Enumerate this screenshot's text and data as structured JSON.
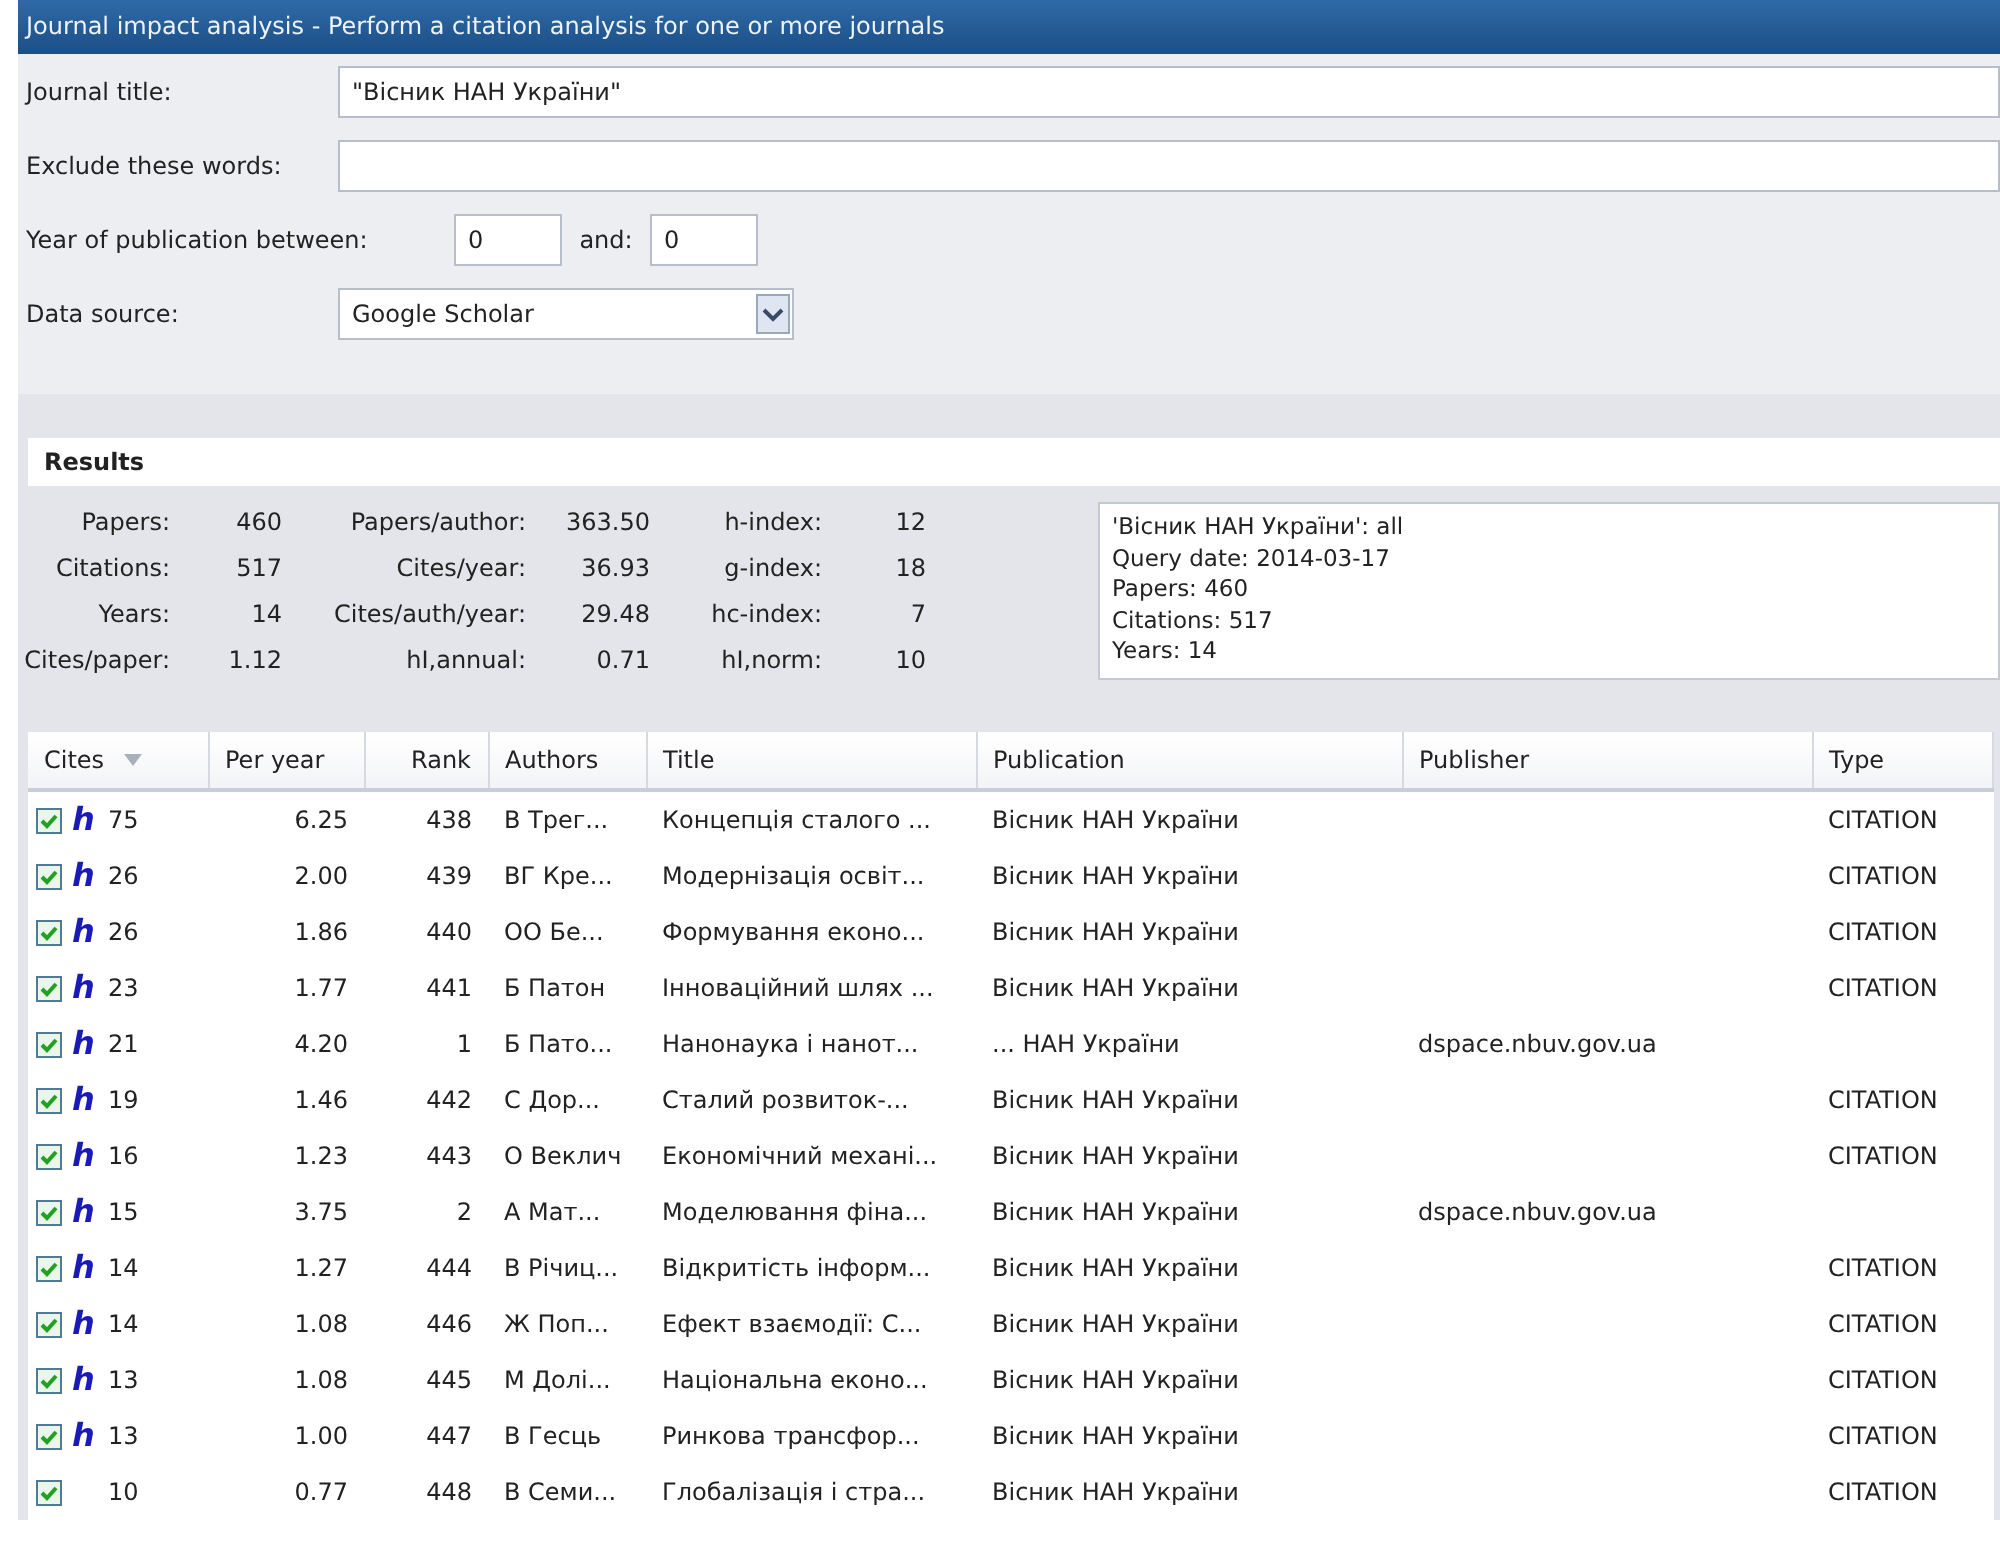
{
  "window": {
    "title": "Journal impact analysis - Perform a citation analysis for one or more journals"
  },
  "form": {
    "journal_title": {
      "label": "Journal title:",
      "value": "\"Вісник НАН України\""
    },
    "exclude": {
      "label": "Exclude these words:"
    },
    "year": {
      "label": "Year of publication between:",
      "from": "0",
      "and_label": "and:",
      "to": "0"
    },
    "data_source": {
      "label": "Data source:",
      "value": "Google Scholar"
    }
  },
  "results": {
    "heading": "Results",
    "stats": [
      [
        {
          "label": "Papers:",
          "value": "460"
        },
        {
          "label": "Papers/author:",
          "value": "363.50"
        },
        {
          "label": "h-index:",
          "value": "12"
        }
      ],
      [
        {
          "label": "Citations:",
          "value": "517"
        },
        {
          "label": "Cites/year:",
          "value": "36.93"
        },
        {
          "label": "g-index:",
          "value": "18"
        }
      ],
      [
        {
          "label": "Years:",
          "value": "14"
        },
        {
          "label": "Cites/auth/year:",
          "value": "29.48"
        },
        {
          "label": "hc-index:",
          "value": "7"
        }
      ],
      [
        {
          "label": "Cites/paper:",
          "value": "1.12"
        },
        {
          "label": "hI,annual:",
          "value": "0.71"
        },
        {
          "label": "hI,norm:",
          "value": "10"
        }
      ]
    ],
    "summary": [
      "'Вісник НАН України': all",
      "Query date: 2014-03-17",
      "Papers: 460",
      "Citations: 517",
      "Years: 14"
    ]
  },
  "table": {
    "columns": [
      {
        "label": "Cites",
        "sorted": true
      },
      {
        "label": "Per year",
        "sorted": false
      },
      {
        "label": "Rank",
        "sorted": false
      },
      {
        "label": "Authors",
        "sorted": false
      },
      {
        "label": "Title",
        "sorted": false
      },
      {
        "label": "Publication",
        "sorted": false
      },
      {
        "label": "Publisher",
        "sorted": false
      },
      {
        "label": "Type",
        "sorted": false
      }
    ],
    "rows": [
      {
        "checked": true,
        "marker": "h",
        "cites": "75",
        "per_year": "6.25",
        "rank": "438",
        "authors": "В Трег...",
        "title": "Концепція сталого ...",
        "publication": "Вісник НАН України",
        "type": "CITATION"
      },
      {
        "checked": true,
        "marker": "h",
        "cites": "26",
        "per_year": "2.00",
        "rank": "439",
        "authors": "ВГ Кре...",
        "title": "Модернізація освіт...",
        "publication": "Вісник НАН України",
        "type": "CITATION"
      },
      {
        "checked": true,
        "marker": "h",
        "cites": "26",
        "per_year": "1.86",
        "rank": "440",
        "authors": "ОО Бе...",
        "title": "Формування еконо...",
        "publication": "Вісник НАН України",
        "type": "CITATION"
      },
      {
        "checked": true,
        "marker": "h",
        "cites": "23",
        "per_year": "1.77",
        "rank": "441",
        "authors": "Б Патон",
        "title": "Інноваційний шлях ...",
        "publication": "Вісник НАН України",
        "type": "CITATION"
      },
      {
        "checked": true,
        "marker": "h",
        "cites": "21",
        "per_year": "4.20",
        "rank": "1",
        "authors": "Б Пато...",
        "title": "Нанонаука і нанот...",
        "publication": "... НАН України",
        "publisher": "dspace.nbuv.gov.ua"
      },
      {
        "checked": true,
        "marker": "h",
        "cites": "19",
        "per_year": "1.46",
        "rank": "442",
        "authors": "С Дор...",
        "title": "Сталий розвиток-...",
        "publication": "Вісник НАН України",
        "type": "CITATION"
      },
      {
        "checked": true,
        "marker": "h",
        "cites": "16",
        "per_year": "1.23",
        "rank": "443",
        "authors": "О Веклич",
        "title": "Економічний механі...",
        "publication": "Вісник НАН України",
        "type": "CITATION"
      },
      {
        "checked": true,
        "marker": "h",
        "cites": "15",
        "per_year": "3.75",
        "rank": "2",
        "authors": "А Мат...",
        "title": "Моделювання фіна...",
        "publication": "Вісник НАН України",
        "publisher": "dspace.nbuv.gov.ua"
      },
      {
        "checked": true,
        "marker": "h",
        "cites": "14",
        "per_year": "1.27",
        "rank": "444",
        "authors": "В Річиц...",
        "title": "Відкритість інформ...",
        "publication": "Вісник НАН України",
        "type": "CITATION"
      },
      {
        "checked": true,
        "marker": "h",
        "cites": "14",
        "per_year": "1.08",
        "rank": "446",
        "authors": "Ж Поп...",
        "title": "Ефект взаємодії: С...",
        "publication": "Вісник НАН України",
        "type": "CITATION"
      },
      {
        "checked": true,
        "marker": "h",
        "cites": "13",
        "per_year": "1.08",
        "rank": "445",
        "authors": "М Долі...",
        "title": "Національна еконо...",
        "publication": "Вісник НАН України",
        "type": "CITATION"
      },
      {
        "checked": true,
        "marker": "h",
        "cites": "13",
        "per_year": "1.00",
        "rank": "447",
        "authors": "В Гесць",
        "title": "Ринкова трансфор...",
        "publication": "Вісник НАН України",
        "type": "CITATION"
      },
      {
        "checked": true,
        "cites": "10",
        "per_year": "0.77",
        "rank": "448",
        "authors": "В Семи...",
        "title": "Глобалізація і стра...",
        "publication": "Вісник НАН України",
        "type": "CITATION"
      }
    ]
  }
}
